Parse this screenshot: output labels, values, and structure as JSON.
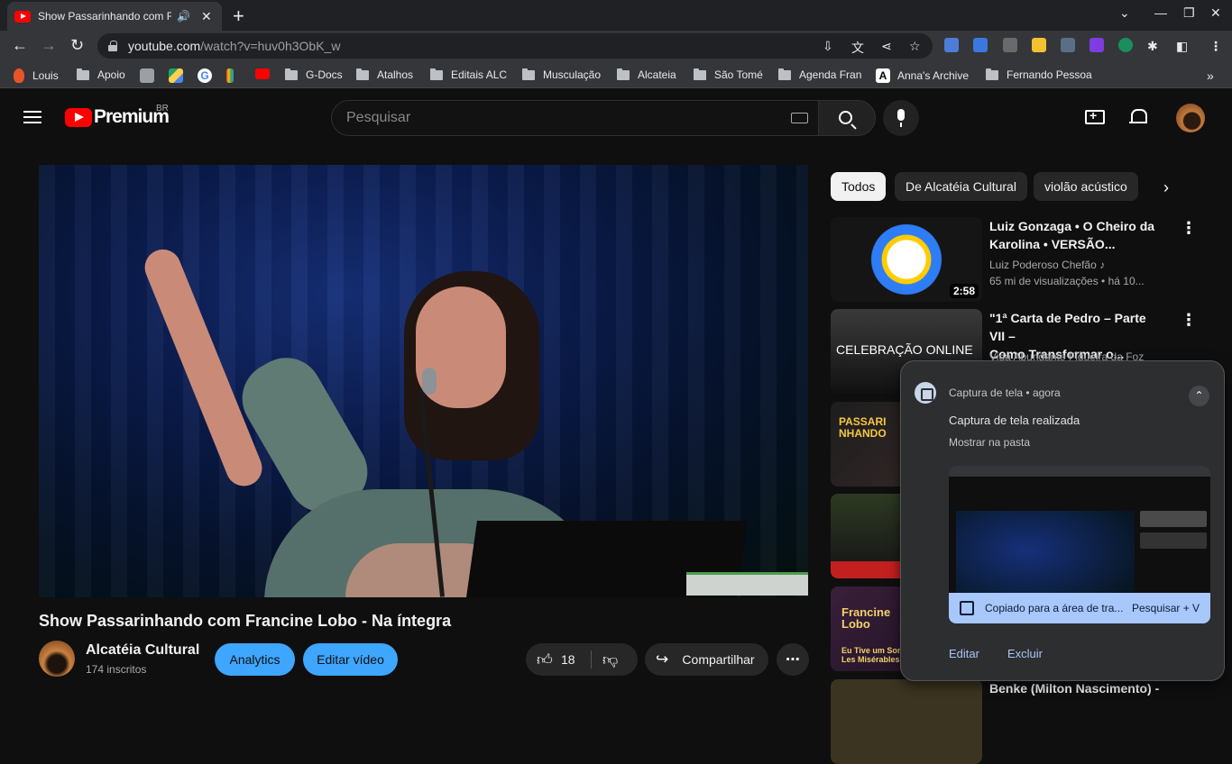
{
  "browser": {
    "tab_title": "Show Passarinhando com F",
    "url_host": "youtube.com",
    "url_path": "/watch?v=huv0h3ObK_w"
  },
  "bookmarks": [
    {
      "label": "Louis"
    },
    {
      "label": "Apoio"
    },
    {
      "label": "G-Docs"
    },
    {
      "label": "Atalhos"
    },
    {
      "label": "Editais ALC"
    },
    {
      "label": "Musculação"
    },
    {
      "label": "Alcateia"
    },
    {
      "label": "São Tomé"
    },
    {
      "label": "Agenda Fran"
    },
    {
      "label": "Anna's Archive"
    },
    {
      "label": "Fernando Pessoa"
    }
  ],
  "header": {
    "logo_text": "Premium",
    "region": "BR",
    "search_placeholder": "Pesquisar"
  },
  "video": {
    "title": "Show Passarinhando com Francine Lobo - Na íntegra",
    "channel_name": "Alcatéia Cultural",
    "subscribers": "174 inscritos",
    "analytics_label": "Analytics",
    "edit_label": "Editar vídeo",
    "like_count": "18",
    "share_label": "Compartilhar"
  },
  "chips": [
    "Todos",
    "De Alcatéia Cultural",
    "violão acústico"
  ],
  "recommendations": [
    {
      "title_line1": "Luiz Gonzaga • O Cheiro da",
      "title_line2": "Karolina • VERSÃO...",
      "channel": "Luiz Poderoso Chefão",
      "stats": "65 mi de visualizações • há 10...",
      "duration": "2:58"
    },
    {
      "title_line1": "\"1ª Carta de Pedro – Parte VII –",
      "title_line2": "Como Transformar o...",
      "channel": "Vida Abundante Figueira da Foz",
      "thumb_text": "CELEBRAÇÃO ONLINE"
    },
    {
      "thumb_text1": "PASSARI",
      "thumb_text2": "NHANDO"
    },
    {},
    {
      "thumb_text1": "Francine",
      "thumb_text2": "Lobo",
      "thumb_text3": "Eu Tive um Sonho",
      "thumb_text4": "Les Misérables"
    },
    {
      "title_line1": "Benke (Milton Nascimento) -"
    }
  ],
  "notification": {
    "app": "Captura de tela",
    "time": "agora",
    "title": "Captura de tela realizada",
    "body": "Mostrar na pasta",
    "banner_text": "Copiado para a área de tra...",
    "banner_action": "Pesquisar + V",
    "action_edit": "Editar",
    "action_delete": "Excluir"
  }
}
